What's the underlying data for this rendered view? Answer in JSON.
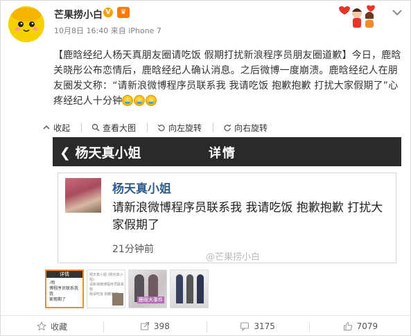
{
  "post": {
    "username": "芒果捞小白",
    "v_badge": "V",
    "member_badge": "♛",
    "time": "10月8日 16:40",
    "source_prefix": "来自",
    "source": "iPhone 7",
    "text": "【鹿晗经纪人杨天真朋友圈请吃饭 假期打扰新浪程序员朋友圈道歉】今日，鹿晗关晓彤公布恋情后，鹿晗经纪人确认消息。之后微博一度崩溃。鹿晗经纪人在朋友圈发文称：“请新浪微博程序员联系我 我请吃饭 抱歉抱歉 打扰大家假期了”心疼经纪人十分钟",
    "emoji_names": [
      "tears-of-joy-emoji",
      "tears-of-joy-emoji",
      "tears-of-joy-emoji"
    ]
  },
  "toolbar": {
    "collapse": "收起",
    "view_large": "查看大图",
    "rotate_left": "向左旋转",
    "rotate_right": "向右旋转"
  },
  "screenshot": {
    "back": "杨天真小姐",
    "title": "详情",
    "name": "杨天真小姐",
    "body": "请新浪微博程序员联系我 我请吃饭 抱歉抱歉 打扰大家假期了",
    "time": "21分钟前",
    "watermark": "@芒果捞小白"
  },
  "thumbnails": {
    "t1_head": "详情",
    "t1_body": "-明\n博程序员联系我 我\n家假期了",
    "t2_lines": "杨天真小姐 (杨天真小姐)\n请新浪微博程序员联系我\n我请吃饭 抱歉抱歉",
    "t3_label": "鹿晗大事件"
  },
  "footer": {
    "favorite": "收藏",
    "shares": "398",
    "comments": "3175",
    "likes": "7079"
  },
  "colors": {
    "accent": "#f28c28",
    "link_blue": "#2d5c8d",
    "dark_header": "#2a2a2a"
  }
}
